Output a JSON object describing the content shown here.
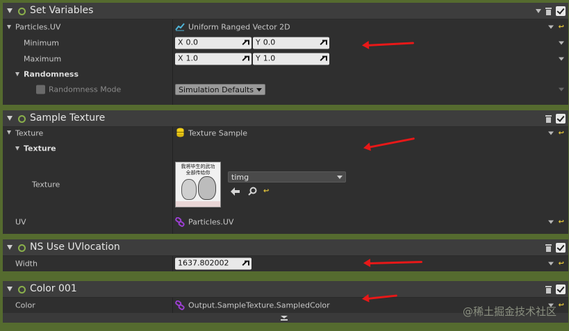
{
  "sv": {
    "title": "Set Variables",
    "particles_uv_label": "Particles.UV",
    "particles_uv_value": "Uniform Ranged Vector 2D",
    "minimum_label": "Minimum",
    "min_x_axis": "X",
    "min_x": "0.0",
    "min_y_axis": "Y",
    "min_y": "0.0",
    "maximum_label": "Maximum",
    "max_x_axis": "X",
    "max_x": "1.0",
    "max_y_axis": "Y",
    "max_y": "1.0",
    "randomness_label": "Randomness",
    "randomness_mode_label": "Randomness Mode",
    "randomness_mode_value": "Simulation Defaults"
  },
  "st": {
    "title": "Sample Texture",
    "texture_label": "Texture",
    "texture_value": "Texture Sample",
    "texture_group_label": "Texture",
    "texture_field_label": "Texture",
    "asset_name": "timg",
    "thumb_text_1": "我将毕生的武功",
    "thumb_text_2": "全部传给你",
    "uv_label": "UV",
    "uv_value": "Particles.UV"
  },
  "ns": {
    "title": "NS Use UVlocation",
    "width_label": "Width",
    "width_value": "1637.802002"
  },
  "c1": {
    "title": "Color 001",
    "color_label": "Color",
    "color_value": "Output.SampleTexture.SampledColor"
  },
  "watermark": "@稀土掘金技术社区",
  "colors": {
    "accent_green": "#8ab04b",
    "annotation_red": "#e81818",
    "background": "#556b2f"
  }
}
